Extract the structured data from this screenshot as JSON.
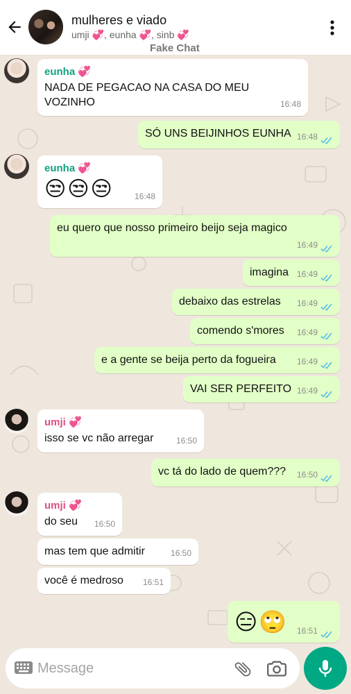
{
  "header": {
    "title": "mulheres e viado",
    "members": "umji 💞, eunha 💞, sinb 💞",
    "fake_tag": "Fake Chat"
  },
  "messages": [
    {
      "sender": "eunha 💞",
      "text": "NADA DE PEGACAO NA CASA DO MEU VOZINHO",
      "time": "16:48"
    },
    {
      "text": "SÓ UNS BEIJINHOS EUNHA",
      "time": "16:48",
      "status": "read"
    },
    {
      "sender": "eunha 💞",
      "text": "😒😒😒",
      "time": "16:48"
    },
    {
      "text": "eu quero que nosso primeiro beijo seja magico",
      "time": "16:49",
      "status": "read"
    },
    {
      "text": "imagina",
      "time": "16:49",
      "status": "read"
    },
    {
      "text": "debaixo das estrelas",
      "time": "16:49",
      "status": "read"
    },
    {
      "text": "comendo s'mores",
      "time": "16:49",
      "status": "read"
    },
    {
      "text": "e a gente se beija perto da fogueira",
      "time": "16:49",
      "status": "read"
    },
    {
      "text": "VAI SER PERFEITO",
      "time": "16:49",
      "status": "read"
    },
    {
      "sender": "umji 💞",
      "text": "isso se vc não arregar",
      "time": "16:50"
    },
    {
      "text": "vc tá do lado de quem???",
      "time": "16:50",
      "status": "read"
    },
    {
      "sender": "umji 💞",
      "text": "do seu",
      "time": "16:50"
    },
    {
      "text": "mas tem que admitir",
      "time": "16:50"
    },
    {
      "text": "você é medroso",
      "time": "16:51"
    },
    {
      "text": "😑🙄",
      "time": "16:51",
      "status": "read"
    }
  ],
  "input": {
    "placeholder": "Message",
    "value": ""
  },
  "colors": {
    "incoming_bubble": "#ffffff",
    "outgoing_bubble": "#e2ffc7",
    "wallpaper": "#efe7dd",
    "accent_green": "#00a884",
    "read_ticks": "#53bdeb",
    "eunha_name": "#11a37f",
    "umji_name": "#d94f84"
  },
  "icons": [
    "back-arrow-icon",
    "more-vert-icon",
    "double-check-icon",
    "keyboard-icon",
    "paperclip-icon",
    "camera-icon",
    "mic-icon"
  ]
}
